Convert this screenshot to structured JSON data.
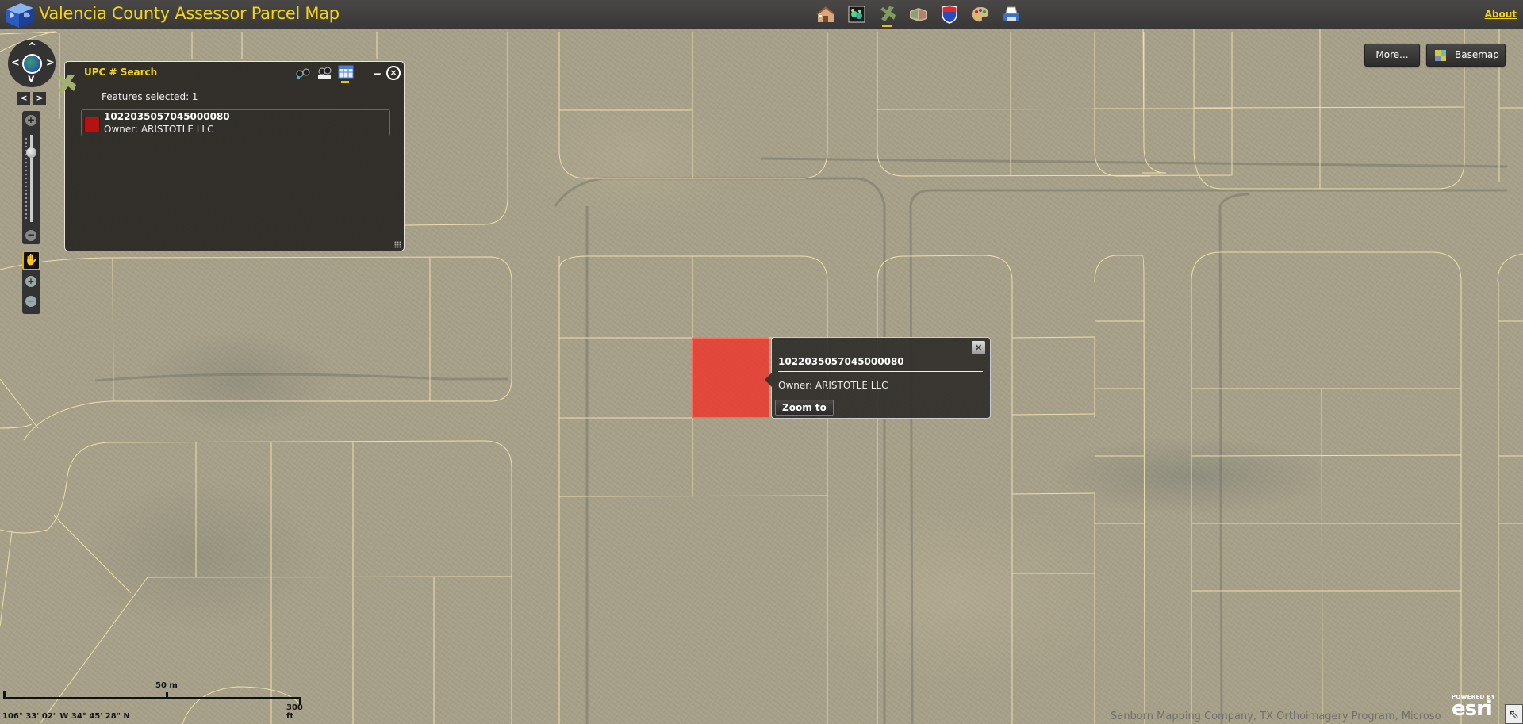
{
  "header": {
    "title": "Valencia County Assessor Parcel Map",
    "about_label": "About",
    "toolbar": [
      {
        "name": "home-widget-icon",
        "label": "Home"
      },
      {
        "name": "layers-widget-icon",
        "label": "Layers"
      },
      {
        "name": "upc-search-widget-icon",
        "label": "UPC # Search",
        "active": true
      },
      {
        "name": "map-widget-icon",
        "label": "Maps"
      },
      {
        "name": "interstate-shield-icon",
        "label": "Roads"
      },
      {
        "name": "palette-widget-icon",
        "label": "Draw"
      },
      {
        "name": "printer-widget-icon",
        "label": "Print"
      }
    ]
  },
  "navigation": {
    "up": "^",
    "down": "v",
    "left": "<",
    "right": ">",
    "prev_extent": "<",
    "next_extent": ">",
    "zoom_in": "+",
    "zoom_out": "−",
    "zoom_level_fraction": 0.2,
    "pan_tool": "✋",
    "zoom_in_tool": "+",
    "zoom_out_tool": "−"
  },
  "search_panel": {
    "title": "UPC # Search",
    "features_selected": "Features selected: 1",
    "close": "×",
    "results": [
      {
        "id": "1022035057045000080",
        "owner": "Owner: ARISTOTLE LLC",
        "color": "#b51212"
      }
    ]
  },
  "popup": {
    "title": "1022035057045000080",
    "owner": "Owner: ARISTOTLE LLC",
    "zoom_to_label": "Zoom to",
    "close": "×"
  },
  "map_controls": {
    "more_label": "More...",
    "basemap_label": "Basemap"
  },
  "scalebar": {
    "metric": "50 m",
    "imperial": "300 ft",
    "coordinates": "106° 33' 02\" W 34° 45' 28\" N"
  },
  "attribution": "Sanborn Mapping Company, TX Orthoimagery Program, Microsoft",
  "esri": {
    "powered_by": "POWERED BY",
    "brand": "esri"
  },
  "overview_toggle": "⇖",
  "colors": {
    "accent": "#f4d417",
    "header_bg": "#3f3d3b",
    "selection_fill": "#f03228",
    "parcel_line": "#f3e6b0"
  }
}
